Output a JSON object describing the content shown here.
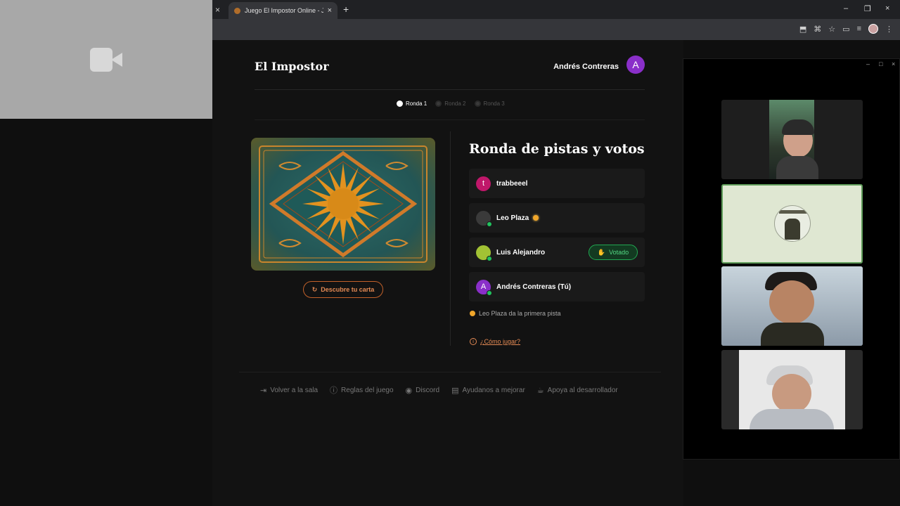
{
  "browser": {
    "tab_title": "Juego El Impostor Online - Jugar",
    "close_symbol": "×",
    "new_tab_symbol": "+",
    "window_controls": [
      "–",
      "❐",
      "×"
    ]
  },
  "app": {
    "brand": "El Impostor",
    "user": {
      "name": "Andrés Contreras",
      "initial": "A"
    },
    "rounds": [
      {
        "label": "Ronda 1",
        "active": true
      },
      {
        "label": "Ronda 2",
        "active": false
      },
      {
        "label": "Ronda 3",
        "active": false
      }
    ],
    "reveal_button": "Descubre tu carta",
    "panel_title": "Ronda de pistas y votos",
    "players": [
      {
        "name": "trabbeeel",
        "initial": "t",
        "color": "#c0176a"
      },
      {
        "name": "Leo Plaza",
        "initial": "",
        "color": "#3a3a3a",
        "clue_giver": true
      },
      {
        "name": "Luis Alejandro",
        "initial": "",
        "color": "#a2c234",
        "voted_label": "Votado"
      },
      {
        "name": "Andrés Contreras (Tú)",
        "initial": "A",
        "color": "#8a2fc9"
      }
    ],
    "hint_text": "Leo Plaza da la primera pista",
    "how_to_play": "¿Cómo jugar?",
    "footer": [
      {
        "icon": "exit-icon",
        "glyph": "⇥",
        "label": "Volver a la sala"
      },
      {
        "icon": "info-icon",
        "glyph": "ⓘ",
        "label": "Reglas del juego"
      },
      {
        "icon": "discord-icon",
        "glyph": "◉",
        "label": "Discord"
      },
      {
        "icon": "feedback-icon",
        "glyph": "▤",
        "label": "Ayudanos a mejorar"
      },
      {
        "icon": "coffee-icon",
        "glyph": "☕",
        "label": "Apoya al desarrollador"
      }
    ]
  },
  "video_panel": {
    "controls": [
      "–",
      "□",
      "×"
    ]
  },
  "colors": {
    "accent_orange": "#e48a54",
    "voted_green": "#21a852",
    "user_purple": "#8a2fc9"
  }
}
